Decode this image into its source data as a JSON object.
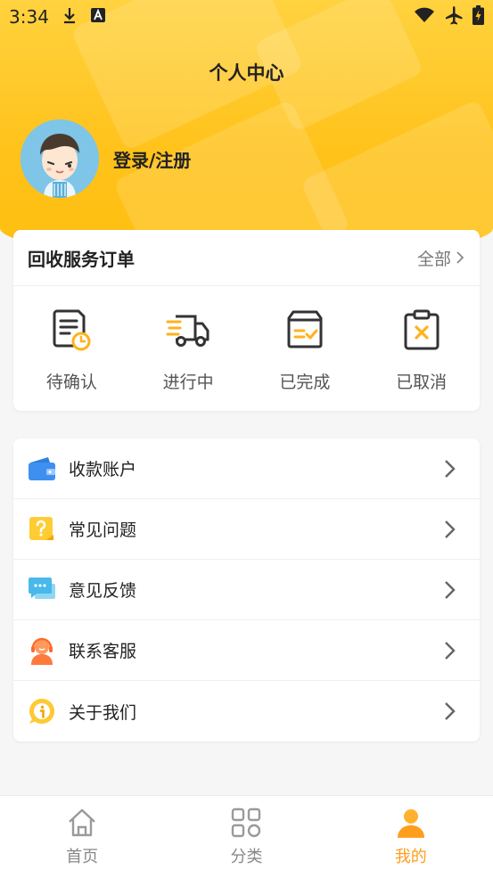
{
  "status_bar": {
    "time": "3:34"
  },
  "page": {
    "title": "个人中心"
  },
  "profile": {
    "login_label": "登录/注册"
  },
  "orders": {
    "title": "回收服务订单",
    "all_label": "全部",
    "items": [
      {
        "label": "待确认",
        "icon": "clipboard-clock-icon"
      },
      {
        "label": "进行中",
        "icon": "delivery-truck-icon"
      },
      {
        "label": "已完成",
        "icon": "box-check-icon"
      },
      {
        "label": "已取消",
        "icon": "clipboard-x-icon"
      }
    ]
  },
  "menu": {
    "items": [
      {
        "label": "收款账户",
        "icon": "wallet-icon"
      },
      {
        "label": "常见问题",
        "icon": "question-icon"
      },
      {
        "label": "意见反馈",
        "icon": "chat-bubble-icon"
      },
      {
        "label": "联系客服",
        "icon": "headset-agent-icon"
      },
      {
        "label": "关于我们",
        "icon": "info-icon"
      }
    ]
  },
  "nav": {
    "items": [
      {
        "label": "首页",
        "icon": "home-icon"
      },
      {
        "label": "分类",
        "icon": "grid-icon"
      },
      {
        "label": "我的",
        "icon": "person-icon",
        "active": true
      }
    ]
  },
  "colors": {
    "accent": "#ffc21a",
    "active_nav": "#ff9d1c"
  }
}
